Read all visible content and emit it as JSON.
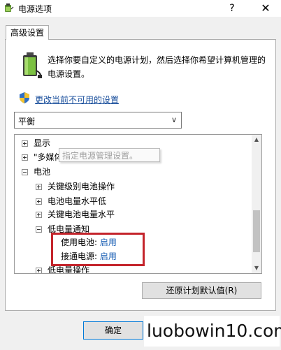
{
  "window": {
    "title": "电源选项",
    "help_label": "?",
    "close_label": "✕"
  },
  "tab": {
    "label": "高级设置"
  },
  "intro": {
    "description": "选择你要自定义的电源计划，然后选择你希望计算机管理的电源设置。",
    "change_link": "更改当前不可用的设置"
  },
  "plan_select": {
    "value": "平衡",
    "chevron": "∨"
  },
  "tree": {
    "rows": [
      {
        "label": "显示"
      },
      {
        "label": "\"多媒体\"设置"
      },
      {
        "label": "电池"
      },
      {
        "label": "关键级别电池操作"
      },
      {
        "label": "电池电量水平低"
      },
      {
        "label": "关键电池电量水平"
      },
      {
        "label": "低电量通知"
      },
      {
        "label": "使用电池:",
        "value": "启用"
      },
      {
        "label": "接通电源:",
        "value": "启用"
      },
      {
        "label": "低电量操作"
      }
    ],
    "tooltip": "指定电源管理设置。",
    "scroll_up": "▲",
    "scroll_down": "▼"
  },
  "buttons": {
    "restore": "还原计划默认值(R)",
    "ok": "确定"
  },
  "watermark": "luobowin10.com",
  "colors": {
    "link": "#1a4f9c",
    "setting_value": "#1a5fb4",
    "highlight": "#c4242b",
    "ok_border": "#0078d7"
  }
}
